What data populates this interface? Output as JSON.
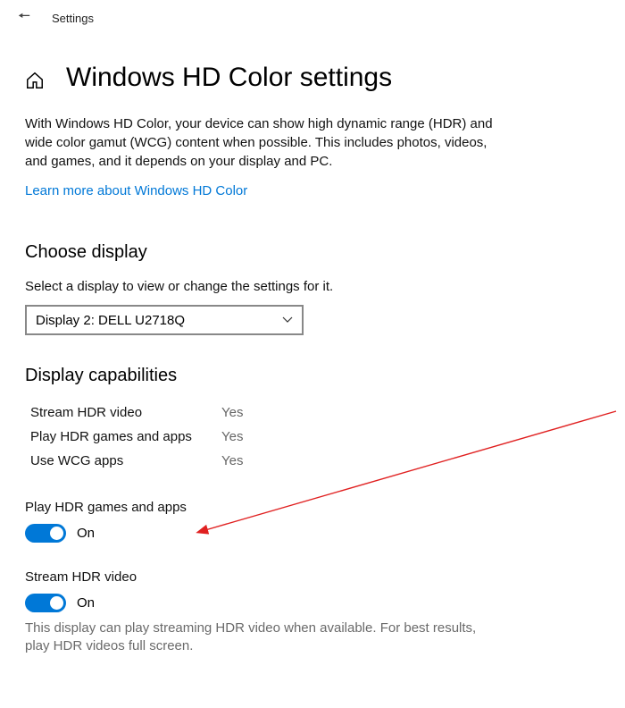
{
  "topbar": {
    "title": "Settings"
  },
  "page": {
    "title": "Windows HD Color settings",
    "intro": "With Windows HD Color, your device can show high dynamic range (HDR) and wide color gamut (WCG) content when possible. This includes photos, videos, and games, and it depends on your display and PC.",
    "learn_more": "Learn more about Windows HD Color"
  },
  "choose_display": {
    "heading": "Choose display",
    "instruction": "Select a display to view or change the settings for it.",
    "selected": "Display 2: DELL U2718Q"
  },
  "capabilities": {
    "heading": "Display capabilities",
    "rows": [
      {
        "label": "Stream HDR video",
        "value": "Yes"
      },
      {
        "label": "Play HDR games and apps",
        "value": "Yes"
      },
      {
        "label": "Use WCG apps",
        "value": "Yes"
      }
    ]
  },
  "toggles": {
    "play_hdr": {
      "label": "Play HDR games and apps",
      "state": "On"
    },
    "stream_hdr": {
      "label": "Stream HDR video",
      "state": "On",
      "note": "This display can play streaming HDR video when available. For best results, play HDR videos full screen."
    }
  }
}
